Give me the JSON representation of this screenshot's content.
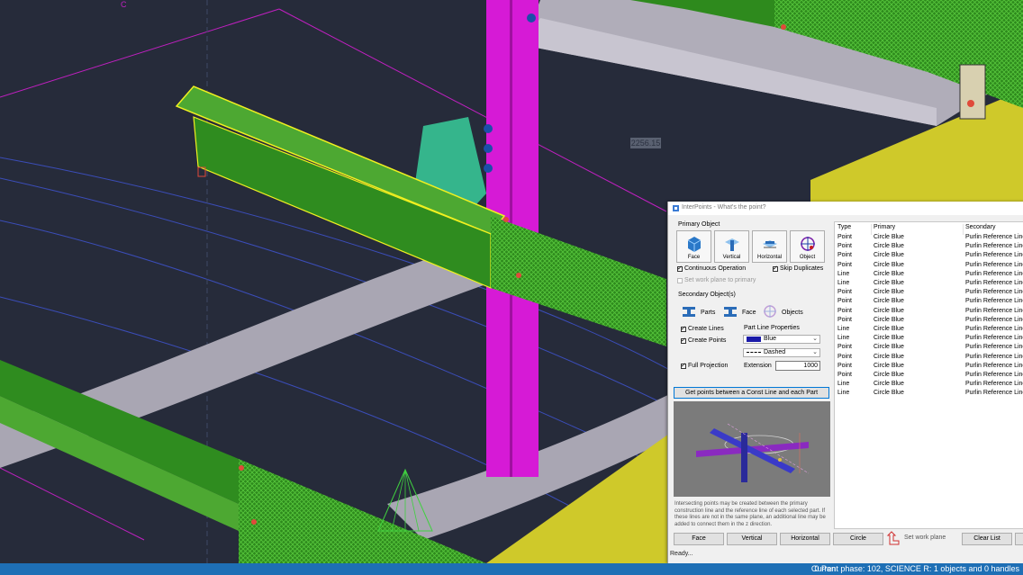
{
  "viewport": {
    "dimension_label": "2256.15",
    "corner_marker": "C"
  },
  "statusbar": {
    "pan": "0 Pan",
    "phase": "Current phase: 102, SCIENCE R: 1 objects and 0 handles"
  },
  "dialog": {
    "title": "InterPoints - What's the point?",
    "primary_object_label": "Primary Object",
    "primary_buttons": [
      {
        "label": "Face",
        "icon": "face-icon"
      },
      {
        "label": "Vertical",
        "icon": "vertical-icon"
      },
      {
        "label": "Horizontal",
        "icon": "horizontal-icon"
      },
      {
        "label": "Object",
        "icon": "object-icon"
      }
    ],
    "continuous_operation": {
      "label": "Continuous Operation",
      "checked": true
    },
    "skip_duplicates": {
      "label": "Skip Duplicates",
      "checked": true
    },
    "set_work_plane_primary": {
      "label": "Set work plane to primary",
      "checked": false
    },
    "secondary_objects_label": "Secondary Object(s)",
    "tabs": [
      {
        "label": "Parts",
        "icon": "parts-icon"
      },
      {
        "label": "Face",
        "icon": "face-icon"
      },
      {
        "label": "Objects",
        "icon": "objects-icon"
      }
    ],
    "create_lines": {
      "label": "Create Lines",
      "checked": true
    },
    "create_points": {
      "label": "Create Points",
      "checked": true
    },
    "full_projection": {
      "label": "Full Projection",
      "checked": true
    },
    "part_line_properties_label": "Part Line Properties",
    "color_select": {
      "value": "Blue",
      "swatch": "#1a1aa8"
    },
    "linetype_select": {
      "value": "Dashed"
    },
    "extension_label": "Extension",
    "extension_value": "1000",
    "main_button": "Get points between a Const Line and each Part",
    "help_text": "Intersecting points may be created between the primary construction line and the reference line of each selected part. If these lines are not in the same plane, an additional line may be added to connect them in the z direction.",
    "table": {
      "headers": [
        "Type",
        "Primary",
        "Secondary"
      ],
      "rows": [
        [
          "Point",
          "Circle Blue",
          "Purlin Reference Line"
        ],
        [
          "Point",
          "Circle Blue",
          "Purlin Reference Line"
        ],
        [
          "Point",
          "Circle Blue",
          "Purlin Reference Line"
        ],
        [
          "Point",
          "Circle Blue",
          "Purlin Reference Line"
        ],
        [
          "Line",
          "Circle Blue",
          "Purlin Reference Line"
        ],
        [
          "Line",
          "Circle Blue",
          "Purlin Reference Line"
        ],
        [
          "Point",
          "Circle Blue",
          "Purlin Reference Line"
        ],
        [
          "Point",
          "Circle Blue",
          "Purlin Reference Line"
        ],
        [
          "Point",
          "Circle Blue",
          "Purlin Reference Line"
        ],
        [
          "Point",
          "Circle Blue",
          "Purlin Reference Line"
        ],
        [
          "Line",
          "Circle Blue",
          "Purlin Reference Line"
        ],
        [
          "Line",
          "Circle Blue",
          "Purlin Reference Line"
        ],
        [
          "Point",
          "Circle Blue",
          "Purlin Reference Line"
        ],
        [
          "Point",
          "Circle Blue",
          "Purlin Reference Line"
        ],
        [
          "Point",
          "Circle Blue",
          "Purlin Reference Line"
        ],
        [
          "Point",
          "Circle Blue",
          "Purlin Reference Line"
        ],
        [
          "Line",
          "Circle Blue",
          "Purlin Reference Line"
        ],
        [
          "Line",
          "Circle Blue",
          "Purlin Reference Line"
        ]
      ]
    },
    "bottom_buttons": {
      "face": "Face",
      "vertical": "Vertical",
      "horizontal": "Horizontal",
      "circle": "Circle",
      "set_work_plane": "Set work plane",
      "clear_list": "Clear List"
    },
    "status": "Ready..."
  }
}
